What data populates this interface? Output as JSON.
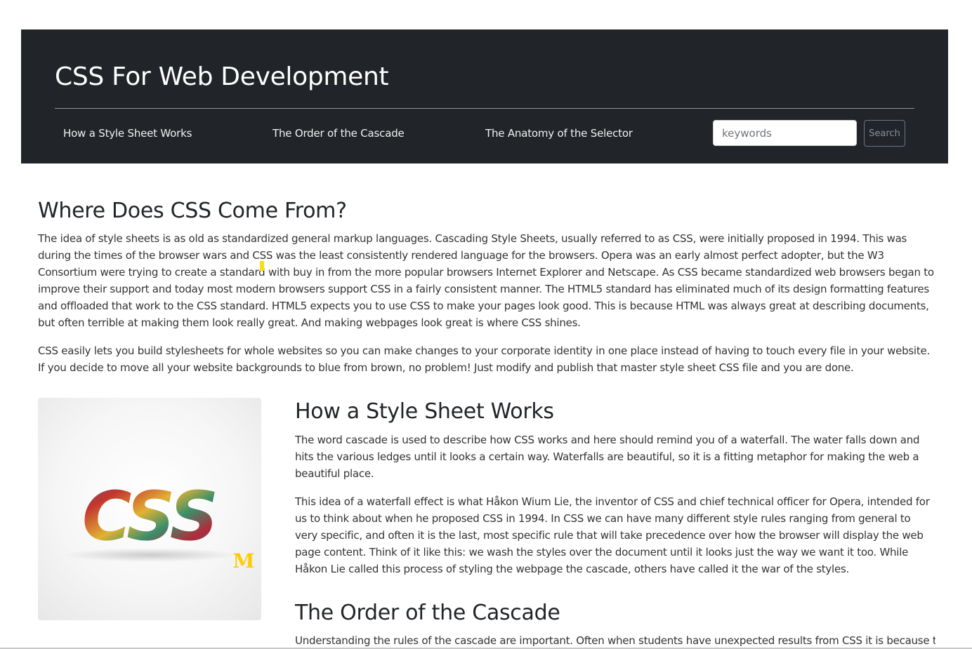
{
  "header": {
    "title": "CSS For Web Development",
    "nav": [
      {
        "label": "How a Style Sheet Works"
      },
      {
        "label": "The Order of the Cascade"
      },
      {
        "label": "The Anatomy of the Selector"
      }
    ],
    "search": {
      "placeholder": "keywords",
      "value": "",
      "button_label": "Search"
    },
    "background_color": "#212529"
  },
  "main": {
    "heading": "Where Does CSS Come From?",
    "paragraphs": [
      "The idea of style sheets is as old as standardized general markup languages. Cascading Style Sheets, usually referred to as CSS, were initially proposed in 1994. This was during the times of the browser wars and CSS was the least consistently rendered language for the browsers. Opera was an early almost perfect adopter, but the W3 Consortium were trying to create a standard with buy in from the more popular browsers Internet Explorer and Netscape. As CSS became standardized web browsers began to improve their support and today most modern browsers support CSS in a fairly consistent manner. The HTML5 standard has eliminated much of its design formatting features and offloaded that work to the CSS standard. HTML5 expects you to use CSS to make your pages look good. This is because HTML was always great at describing documents, but often terrible at making them look really great. And making webpages look great is where CSS shines.",
      "CSS easily lets you build stylesheets for whole websites so you can make changes to your corporate identity in one place instead of having to touch every file in your website. If you decide to move all your website backgrounds to blue from brown, no problem! Just modify and publish that master style sheet CSS file and you are done."
    ]
  },
  "logo": {
    "text": "CSS",
    "badge": "M",
    "badge_color": "#ffcb05"
  },
  "sections": [
    {
      "heading": "How a Style Sheet Works",
      "paragraphs": [
        "The word cascade is used to describe how CSS works and here should remind you of a waterfall. The water falls down and hits the various ledges until it looks a certain way. Waterfalls are beautiful, so it is a fitting metaphor for making the web a beautiful place.",
        "This idea of a waterfall effect is what Håkon Wium Lie, the inventor of CSS and chief technical officer for Opera, intended for us to think about when he proposed CSS in 1994. In CSS we can have many different style rules ranging from general to very specific, and often it is the last, most specific rule that will take precedence over how the browser will display the web page content. Think of it like this: we wash the styles over the document until it looks just the way we want it too. While Håkon Lie called this process of styling the webpage the cascade, others have called it the war of the styles."
      ]
    },
    {
      "heading": "The Order of the Cascade",
      "paragraphs": [
        "Understanding the rules of the cascade are important. Often when students have unexpected results from CSS it is because they"
      ]
    }
  ]
}
